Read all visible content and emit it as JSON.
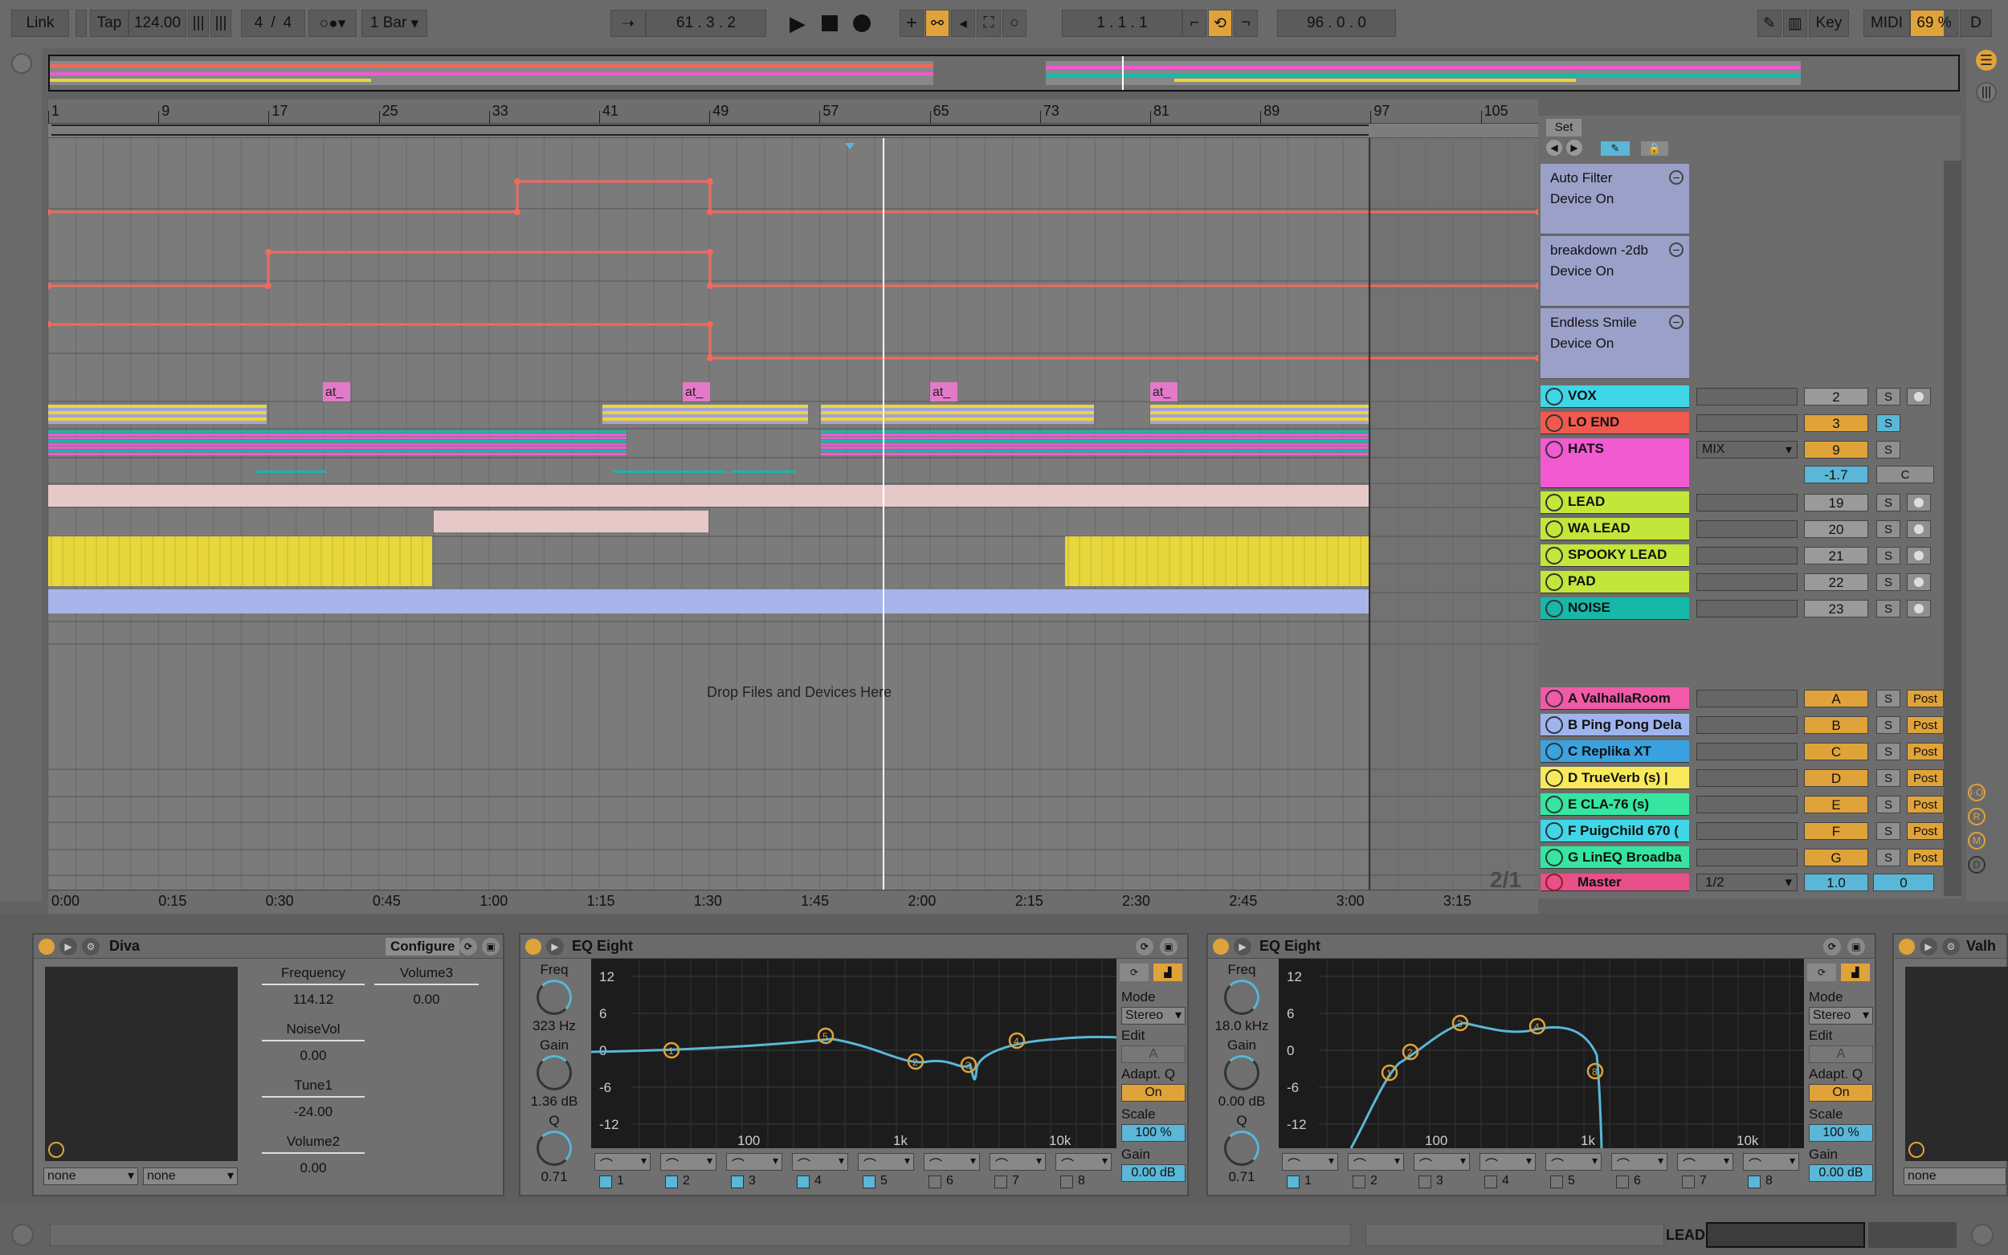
{
  "transport": {
    "link": "Link",
    "tap": "Tap",
    "tempo": "124.00",
    "signature_num": "4",
    "signature_sep": "/",
    "signature_den": "4",
    "quantize": "1 Bar",
    "position": "61 .  3 .  2",
    "loop_start": "1 .  1 .  1",
    "loop_length": "96 .  0 .  0",
    "key_label": "Key",
    "midi_label": "MIDI",
    "cpu": "69 %",
    "d_label": "D"
  },
  "ruler": {
    "bars": [
      "1",
      "9",
      "17",
      "25",
      "33",
      "41",
      "49",
      "57",
      "65",
      "73",
      "81",
      "89",
      "97",
      "105"
    ]
  },
  "timeline": {
    "times": [
      "0:00",
      "0:15",
      "0:30",
      "0:45",
      "1:00",
      "1:15",
      "1:30",
      "1:45",
      "2:00",
      "2:15",
      "2:30",
      "2:45",
      "3:00",
      "3:15"
    ],
    "zoom": "2/1",
    "drop_text": "Drop Files and Devices Here"
  },
  "clips": {
    "marker_label": "at_"
  },
  "tracks": {
    "set_label": "Set",
    "automation": [
      {
        "name": "Auto Filter",
        "param": "Device On"
      },
      {
        "name": "breakdown -2db",
        "param": "Device On"
      },
      {
        "name": "Endless Smile",
        "param": "Device On"
      }
    ],
    "list": [
      {
        "name": "VOX",
        "num": "2",
        "s": "S",
        "color": "#3fd6e8"
      },
      {
        "name": "LO END",
        "num": "3",
        "s": "S",
        "color": "#f05a4e"
      },
      {
        "name": "HATS",
        "num": "9",
        "s": "S",
        "color": "#f25ad2",
        "route": "MIX",
        "pan": "-1.7",
        "c": "C"
      },
      {
        "name": "LEAD",
        "num": "19",
        "s": "S",
        "color": "#c3e63a"
      },
      {
        "name": "WA LEAD",
        "num": "20",
        "s": "S",
        "color": "#c3e63a"
      },
      {
        "name": "SPOOKY LEAD",
        "num": "21",
        "s": "S",
        "color": "#c3e63a"
      },
      {
        "name": "PAD",
        "num": "22",
        "s": "S",
        "color": "#c3e63a"
      },
      {
        "name": "NOISE",
        "num": "23",
        "s": "S",
        "color": "#17b8a8"
      }
    ],
    "returns": [
      {
        "name": "A ValhallaRoom",
        "letter": "A",
        "s": "S",
        "post": "Post",
        "color": "#f05aa6"
      },
      {
        "name": "B Ping Pong Dela",
        "letter": "B",
        "s": "S",
        "post": "Post",
        "color": "#9fb4ee"
      },
      {
        "name": "C Replika XT",
        "letter": "C",
        "s": "S",
        "post": "Post",
        "color": "#3aa2e0"
      },
      {
        "name": "D TrueVerb (s) |",
        "letter": "D",
        "s": "S",
        "post": "Post",
        "color": "#f7e95a"
      },
      {
        "name": "E CLA-76 (s)",
        "letter": "E",
        "s": "S",
        "post": "Post",
        "color": "#35e5a0"
      },
      {
        "name": "F PuigChild 670 (",
        "letter": "F",
        "s": "S",
        "post": "Post",
        "color": "#3fd6e8"
      },
      {
        "name": "G LinEQ Broadba",
        "letter": "G",
        "s": "S",
        "post": "Post",
        "color": "#35e5a0"
      }
    ],
    "master": {
      "name": "Master",
      "route": "1/2",
      "vol": "1.0",
      "pan": "0",
      "color": "#e8508a"
    }
  },
  "diva": {
    "title": "Diva",
    "configure": "Configure",
    "params": [
      {
        "label": "Frequency",
        "value": "114.12"
      },
      {
        "label": "Volume3",
        "value": "0.00"
      },
      {
        "label": "NoiseVol",
        "value": "0.00"
      },
      {
        "label": "Tune1",
        "value": "-24.00"
      },
      {
        "label": "Volume2",
        "value": "0.00"
      }
    ],
    "sel1": "none",
    "sel2": "none"
  },
  "eq1": {
    "title": "EQ Eight",
    "freq_label": "Freq",
    "freq_value": "323 Hz",
    "gain_label": "Gain",
    "gain_value": "1.36 dB",
    "q_label": "Q",
    "q_value": "0.71",
    "db": [
      "12",
      "6",
      "0",
      "-6",
      "-12"
    ],
    "hz": [
      "100",
      "1k",
      "10k"
    ],
    "bands": [
      "1",
      "2",
      "3",
      "4",
      "5",
      "6",
      "7",
      "8"
    ],
    "mode_label": "Mode",
    "mode": "Stereo",
    "edit_label": "Edit",
    "edit": "A",
    "adaptq_label": "Adapt. Q",
    "adaptq": "On",
    "scale_label": "Scale",
    "scale": "100 %",
    "out_gain_label": "Gain",
    "out_gain": "0.00 dB"
  },
  "eq2": {
    "title": "EQ Eight",
    "freq_label": "Freq",
    "freq_value": "18.0 kHz",
    "gain_label": "Gain",
    "gain_value": "0.00 dB",
    "q_label": "Q",
    "q_value": "0.71",
    "db": [
      "12",
      "6",
      "0",
      "-6",
      "-12"
    ],
    "hz": [
      "100",
      "1k",
      "10k"
    ],
    "bands": [
      "1",
      "2",
      "3",
      "4",
      "5",
      "6",
      "7",
      "8"
    ],
    "mode_label": "Mode",
    "mode": "Stereo",
    "edit_label": "Edit",
    "edit": "A",
    "adaptq_label": "Adapt. Q",
    "adaptq": "On",
    "scale_label": "Scale",
    "scale": "100 %",
    "out_gain_label": "Gain",
    "out_gain": "0.00 dB"
  },
  "valhalla": {
    "title": "Valh",
    "sel": "none"
  },
  "status": {
    "track": "LEAD"
  },
  "side": {
    "io": "I·O",
    "r": "R",
    "m": "M",
    "d": "D"
  },
  "colors": {
    "accent": "#e0a33a",
    "automation": "#f26a5c",
    "playhead": "#ffffff",
    "eq_curve": "#5ab7d7"
  }
}
